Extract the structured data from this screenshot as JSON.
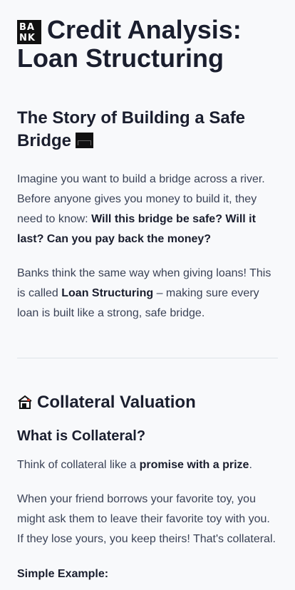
{
  "header": {
    "icon_text_top": "BA",
    "icon_text_bottom": "NK",
    "title": "Credit Analysis: Loan Structuring"
  },
  "story": {
    "heading": "The Story of Building a Safe Bridge",
    "p1_intro": "Imagine you want to build a bridge across a river. Before anyone gives you money to build it, they need to know: ",
    "p1_bold": "Will this bridge be safe? Will it last? Can you pay back the money?",
    "p2_start": "Banks think the same way when giving loans! This is called ",
    "p2_bold": "Loan Structuring",
    "p2_end": " – making sure every loan is built like a strong, safe bridge."
  },
  "collateral": {
    "heading": "Collateral Valuation",
    "subheading": "What is Collateral?",
    "p1_start": "Think of collateral like a ",
    "p1_bold": "promise with a prize",
    "p1_end": ".",
    "p2": "When your friend borrows your favorite toy, you might ask them to leave their favorite toy with you. If they lose yours, you keep theirs! That's collateral.",
    "example_label": "Simple Example:"
  }
}
